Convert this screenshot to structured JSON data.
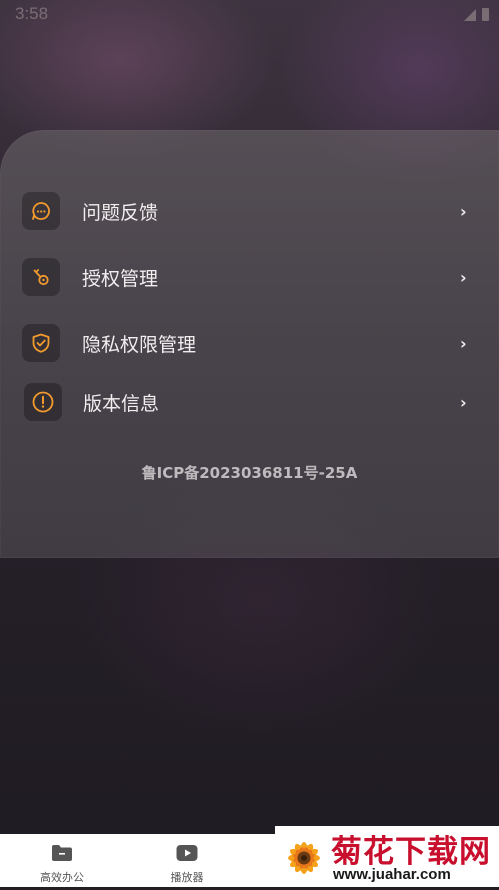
{
  "status_bar": {
    "time": "3:58"
  },
  "menu": {
    "items": [
      {
        "label": "问题反馈",
        "icon": "message-bubble-icon",
        "chevron": "›"
      },
      {
        "label": "授权管理",
        "icon": "key-icon",
        "chevron": "›"
      },
      {
        "label": "隐私权限管理",
        "icon": "shield-check-icon",
        "chevron": "›"
      },
      {
        "label": "版本信息",
        "icon": "info-circle-icon",
        "chevron": "›"
      }
    ],
    "icp": "鲁ICP备2023036811号-25A"
  },
  "tabbar": {
    "tabs": [
      {
        "label": "高效办公",
        "icon": "folder-icon"
      },
      {
        "label": "播放器",
        "icon": "play-icon"
      }
    ]
  },
  "watermark": {
    "title": "菊花下载网",
    "url": "www.juahar.com"
  },
  "colors": {
    "accent": "#f29a2e",
    "card_text": "#f0eeef",
    "watermark_red": "#c8102e"
  }
}
